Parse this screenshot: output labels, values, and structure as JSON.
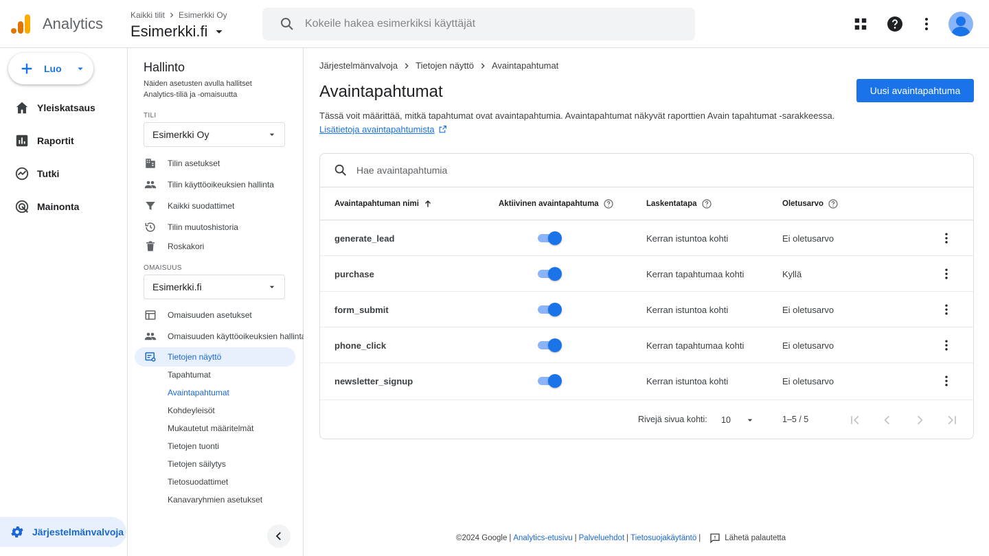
{
  "header": {
    "app_name": "Analytics",
    "breadcrumb": [
      "Kaikki tilit",
      "Esimerkki Oy"
    ],
    "property_name": "Esimerkki.fi",
    "search_placeholder": "Kokeile hakea esimerkiksi käyttäjät",
    "icons": [
      "apps-icon",
      "help-icon",
      "more-vert-icon",
      "avatar"
    ]
  },
  "leftnav": {
    "create_label": "Luo",
    "items": [
      {
        "label": "Yleiskatsaus",
        "icon": "home-icon"
      },
      {
        "label": "Raportit",
        "icon": "bar-chart-icon"
      },
      {
        "label": "Tutki",
        "icon": "explore-icon"
      },
      {
        "label": "Mainonta",
        "icon": "advertising-icon"
      }
    ],
    "admin_label": "Järjestelmänvalvoja"
  },
  "adminpanel": {
    "title": "Hallinto",
    "description": "Näiden asetusten avulla hallitset Analytics-tiliä ja -omaisuutta",
    "account_section": "TILI",
    "account_value": "Esimerkki Oy",
    "account_items": [
      {
        "label": "Tilin asetukset",
        "icon": "building-icon"
      },
      {
        "label": "Tilin käyttöoikeuksien hallinta",
        "icon": "people-icon"
      },
      {
        "label": "Kaikki suodattimet",
        "icon": "filter-icon"
      },
      {
        "label": "Tilin muutoshistoria",
        "icon": "history-icon"
      },
      {
        "label": "Roskakori",
        "icon": "trash-icon"
      }
    ],
    "property_section": "OMAISUUS",
    "property_value": "Esimerkki.fi",
    "property_items": [
      {
        "label": "Omaisuuden asetukset",
        "icon": "table-layout-icon"
      },
      {
        "label": "Omaisuuden käyttöoikeuksien hallinta",
        "icon": "people-icon"
      },
      {
        "label": "Tietojen näyttö",
        "icon": "data-display-icon"
      }
    ],
    "sub_items": [
      "Tapahtumat",
      "Avaintapahtumat",
      "Kohdeyleisöt",
      "Mukautetut määritelmät",
      "Tietojen tuonti",
      "Tietojen säilytys",
      "Tietosuodattimet",
      "Kanavaryhmien asetukset"
    ]
  },
  "main": {
    "breadcrumb": [
      "Järjestelmänvalvoja",
      "Tietojen näyttö",
      "Avaintapahtumat"
    ],
    "title": "Avaintapahtumat",
    "primary_button": "Uusi avaintapahtuma",
    "description": "Tässä voit määrittää, mitkä tapahtumat ovat avaintapahtumia. Avaintapahtumat näkyvät raporttien Avain tapahtumat -sarakkeessa.",
    "learn_more": "Lisätietoja avaintapahtumista",
    "table_search_placeholder": "Hae avaintapahtumia",
    "columns": [
      "Avaintapahtuman nimi",
      "Aktiivinen avaintapahtuma",
      "Laskentatapa",
      "Oletusarvo"
    ],
    "rows": [
      {
        "name": "generate_lead",
        "active": true,
        "method": "Kerran istuntoa kohti",
        "default": "Ei oletusarvo"
      },
      {
        "name": "purchase",
        "active": true,
        "method": "Kerran tapahtumaa kohti",
        "default": "Kyllä"
      },
      {
        "name": "form_submit",
        "active": true,
        "method": "Kerran istuntoa kohti",
        "default": "Ei oletusarvo"
      },
      {
        "name": "phone_click",
        "active": true,
        "method": "Kerran tapahtumaa kohti",
        "default": "Ei oletusarvo"
      },
      {
        "name": "newsletter_signup",
        "active": true,
        "method": "Kerran istuntoa kohti",
        "default": "Ei oletusarvo"
      }
    ],
    "pagination": {
      "rows_label": "Rivejä sivua kohti:",
      "rows_per_page": "10",
      "range": "1–5 / 5"
    }
  },
  "footer": {
    "copyright": "©2024 Google",
    "links": [
      "Analytics-etusivu",
      "Palveluehdot",
      "Tietosuojakäytäntö"
    ],
    "feedback": "Lähetä palautetta"
  },
  "colors": {
    "accent": "#1a73e8",
    "active_bg": "#e8f0fe",
    "active_text": "#1967d2",
    "toggle_track": "#8ab4f8",
    "logo_orange": "#f9ab00",
    "logo_dark_orange": "#e37400"
  }
}
